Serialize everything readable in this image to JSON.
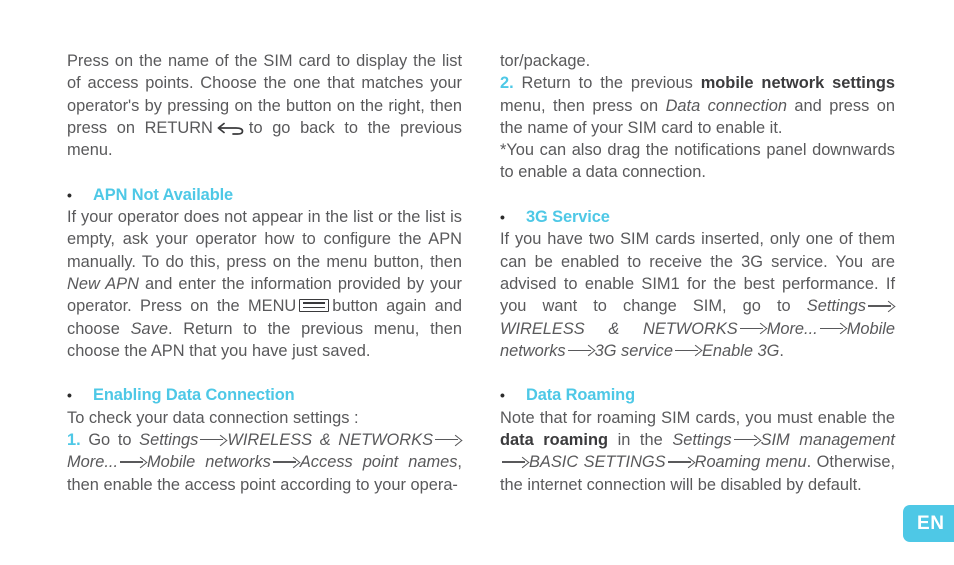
{
  "page": {
    "language_badge": "EN"
  },
  "left_column": {
    "intro": {
      "part1": "Press on the name of the SIM card to display the list of access points. Choose the one that matches your operator's by pressing on the button on the right, then press on RETURN",
      "icon": "return-key-icon",
      "part2": "to go back to the previous menu."
    },
    "section_apn": {
      "bullet": "•",
      "heading": "APN Not Available",
      "body_part1": "If your operator does not appear in the list or the list is empty, ask your operator how to configure the APN manually. To do this, press on the menu button, then ",
      "italic1": "New APN",
      "body_part2": " and enter the information provided by your operator. Press on the MENU",
      "icon": "menu-key-icon",
      "body_part3": "button again and choose ",
      "italic2": "Save",
      "body_part4": ". Return to the previous menu, then choose the APN that you have just saved."
    },
    "section_data_connection": {
      "bullet": "•",
      "heading": "Enabling Data Connection",
      "intro_line": "To check your data connection settings :",
      "step_number": "1.",
      "step_text_pre": " Go to ",
      "path": [
        "Settings",
        "WIRELESS & NETWORKS",
        "More...",
        "Mobile networks",
        "Access point names"
      ],
      "step_text_post": ", then enable the access point according to your opera-"
    }
  },
  "right_column": {
    "continuation": "tor/package.",
    "step2": {
      "number": "2.",
      "text_pre": " Return to the previous ",
      "bold1": "mobile network settings",
      "text_mid": " menu, then press on ",
      "italic1": "Data connection",
      "text_post": " and press on the name of your SIM card to enable it."
    },
    "note": "*You can also drag the notifications panel downwards to enable a data connection.",
    "section_3g": {
      "bullet": "•",
      "heading": "3G Service",
      "body_pre": "If you have two SIM cards inserted, only one of them can be enabled to receive the 3G service. You are advised to enable SIM1 for the best performance. If you want to change SIM, go to ",
      "path": [
        "Settings",
        "WIRELESS & NETWORKS",
        "More...",
        "Mobile networks",
        "3G service",
        "Enable 3G"
      ],
      "body_post": "."
    },
    "section_roaming": {
      "bullet": "•",
      "heading": "Data Roaming",
      "body_pre": "Note that for roaming SIM cards, you must enable the ",
      "bold1": "data roaming",
      "text_mid": " in the ",
      "path": [
        "Settings",
        "SIM management",
        "BASIC SETTINGS",
        "Roaming menu"
      ],
      "body_post": ". Otherwise, the internet connection will be disabled by default."
    }
  },
  "colors": {
    "accent": "#4ec8e6",
    "body_text": "#59595b",
    "icon_dark": "#3a3a3c",
    "background": "#ffffff"
  }
}
